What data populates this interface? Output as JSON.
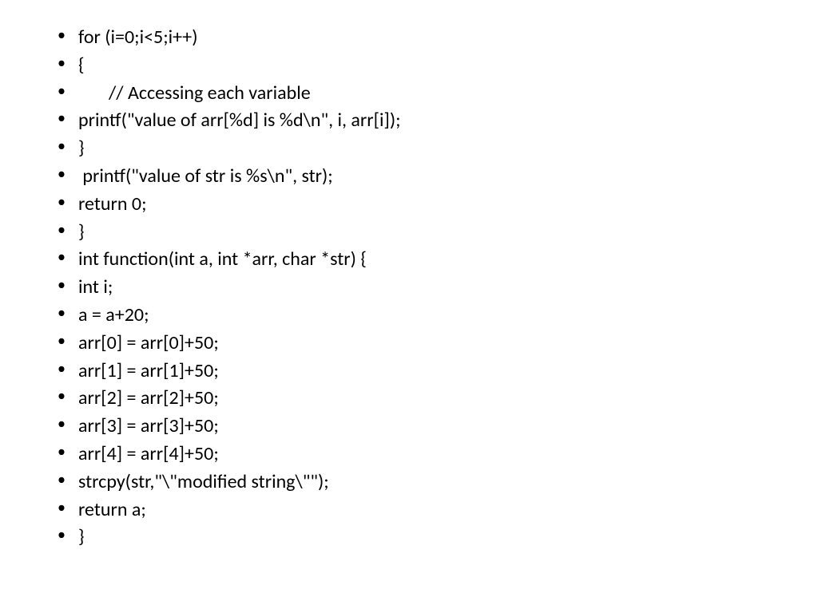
{
  "lines": [
    "for (i=0;i<5;i++)",
    "{",
    "       // Accessing each variable",
    "printf(\"value of arr[%d] is %d\\n\", i, arr[i]);",
    "}",
    " printf(\"value of str is %s\\n\", str);",
    "return 0;",
    "}",
    "int function(int a, int *arr, char *str) {",
    "int i;",
    "a = a+20;",
    "arr[0] = arr[0]+50;",
    "arr[1] = arr[1]+50;",
    "arr[2] = arr[2]+50;",
    "arr[3] = arr[3]+50;",
    "arr[4] = arr[4]+50;",
    "strcpy(str,\"\\\"modified string\\\"\");",
    "return a;",
    "}"
  ]
}
